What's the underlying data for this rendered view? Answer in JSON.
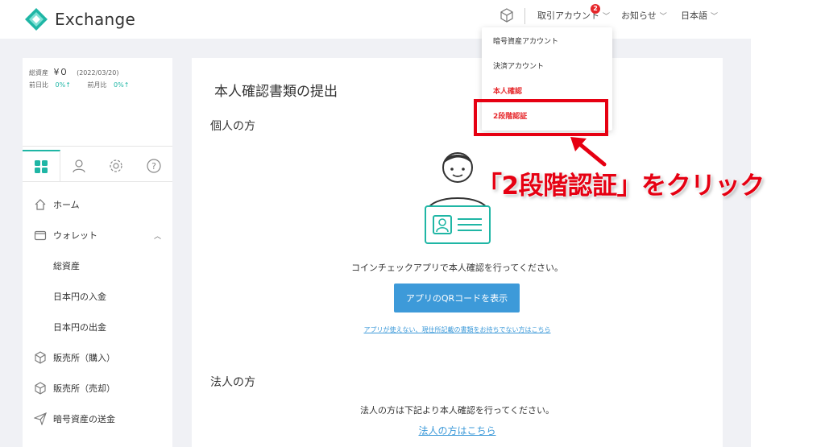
{
  "header": {
    "app_name": "Exchange",
    "nav": {
      "trading_account": "取引アカウント",
      "badge_count": "2",
      "notifications": "お知らせ",
      "language": "日本語"
    }
  },
  "dropdown": {
    "items": [
      {
        "label": "暗号資産アカウント",
        "highlight": false
      },
      {
        "label": "決済アカウント",
        "highlight": false
      },
      {
        "label": "本人確認",
        "highlight": true
      },
      {
        "label": "2段階認証",
        "highlight": true
      }
    ]
  },
  "sidebar": {
    "summary": {
      "total_label": "総資産",
      "total_value": "¥０",
      "date": "(2022/03/20)",
      "day_label": "前日比",
      "day_change": "0%↑",
      "month_label": "前月比",
      "month_change": "0%↑"
    },
    "tabs": [
      "dashboard-icon",
      "user-icon",
      "gear-icon",
      "help-icon"
    ],
    "menu": [
      {
        "label": "ホーム",
        "icon": "home-icon"
      },
      {
        "label": "ウォレット",
        "icon": "wallet-icon",
        "expanded": true
      },
      {
        "label": "総資産",
        "sub": true
      },
      {
        "label": "日本円の入金",
        "sub": true
      },
      {
        "label": "日本円の出金",
        "sub": true
      },
      {
        "label": "販売所（購入）",
        "icon": "cube-icon"
      },
      {
        "label": "販売所（売却）",
        "icon": "cube-icon"
      },
      {
        "label": "暗号資産の送金",
        "icon": "send-icon"
      }
    ]
  },
  "main": {
    "title": "本人確認書類の提出",
    "individual": {
      "heading": "個人の方",
      "description": "コインチェックアプリで本人確認を行ってください。",
      "qr_button": "アプリのQRコードを表示",
      "small_link": "アプリが使えない、現住所記載の書類をお持ちでない方はこちら"
    },
    "corporate": {
      "heading": "法人の方",
      "description": "法人の方は下記より本人確認を行ってください。",
      "link": "法人の方はこちら"
    }
  },
  "annotation": {
    "callout": "「2段階認証」をクリック",
    "color": "#e60012"
  },
  "colors": {
    "accent": "#1fb6a5",
    "button": "#3d9ad9",
    "alert": "#e6262a"
  }
}
